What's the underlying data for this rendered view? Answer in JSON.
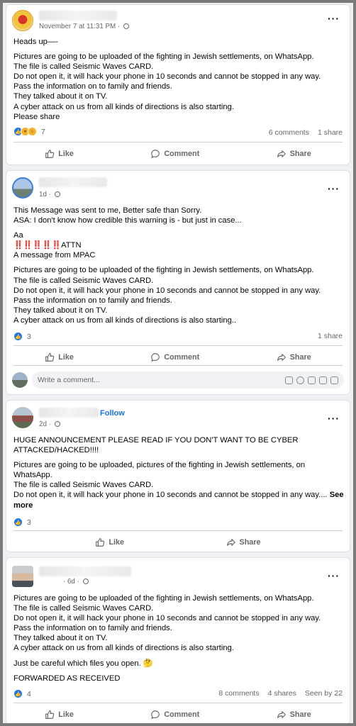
{
  "posts": [
    {
      "meta": "November 7 at 11:31 PM · ",
      "lines": [
        "Heads up—-",
        "",
        "Pictures are going to be uploaded of the fighting in Jewish settlements, on WhatsApp.",
        "The file is called Seismic Waves CARD.",
        "Do not open it, it will hack your phone in 10 seconds and cannot be stopped in any way.",
        "Pass the information on to family and friends.",
        "They talked about it on TV.",
        "A cyber attack on us from all kinds of directions is also starting.",
        "Please share"
      ],
      "reactions": [
        "like-reaction-icon",
        "care-reaction-icon",
        "wow-reaction-icon"
      ],
      "reaction_count": "7",
      "stats": [
        "6 comments",
        "1 share"
      ],
      "actions": [
        "Like",
        "Comment",
        "Share"
      ]
    },
    {
      "meta": "1d · ",
      "lines_top": [
        "This Message was sent to me, Better safe than Sorry.",
        "ASA: I don't know how credible this warning is - but just in case..."
      ],
      "aa": "Aa",
      "attn_marks": "‼️‼️‼️‼️‼️",
      "attn": "ATTN",
      "mpac": "A message from MPAC",
      "lines": [
        "Pictures are going to be uploaded of the fighting in Jewish settlements, on WhatsApp.",
        "The file is called Seismic Waves CARD.",
        "Do not open it, it will hack your phone in 10 seconds and cannot be stopped in any way.",
        "Pass the information on to family and friends.",
        "They talked about it on TV.",
        "A cyber attack on us from all kinds of directions is also starting.."
      ],
      "reaction_count": "3",
      "stats": [
        "1 share"
      ],
      "actions": [
        "Like",
        "Comment",
        "Share"
      ],
      "comment_placeholder": "Write a comment..."
    },
    {
      "meta": "2d · ",
      "follow": "Follow",
      "headline": "HUGE ANNOUNCEMENT PLEASE READ IF YOU DON'T WANT TO BE CYBER ATTACKED/HACKED!!!!",
      "lines": [
        "Pictures are going to be uploaded, pictures of the fighting in Jewish settlements, on WhatsApp.",
        "The file is called Seismic Waves CARD."
      ],
      "last_line": "Do not open it, it will hack your phone in 10 seconds and cannot be stopped in any way.... ",
      "see_more": "See more",
      "reaction_count": "3",
      "actions": [
        "Like",
        "Share"
      ]
    },
    {
      "meta": "· 6d · ",
      "lines": [
        "Pictures are going to be uploaded of the fighting in Jewish settlements, on WhatsApp.",
        "The file is called Seismic Waves CARD.",
        "Do not open it, it will hack your phone in 10 seconds and cannot be stopped in any way.",
        "Pass the information on to family and friends.",
        "They talked about it on TV.",
        "A cyber attack on us from all kinds of directions is also starting."
      ],
      "careful": "Just be careful which files you open. 🤔",
      "forwarded": "FORWARDED AS RECEIVED",
      "reaction_count": "4",
      "stats": [
        "8 comments",
        "4 shares",
        "Seen by 22"
      ],
      "actions": [
        "Like",
        "Comment",
        "Share"
      ]
    }
  ],
  "more_icon": "more-options-icon",
  "colors": {
    "link_blue": "#1b74e4",
    "like_blue": "#1877f2",
    "muted": "#65676b",
    "alert_red": "#e41e3f"
  }
}
